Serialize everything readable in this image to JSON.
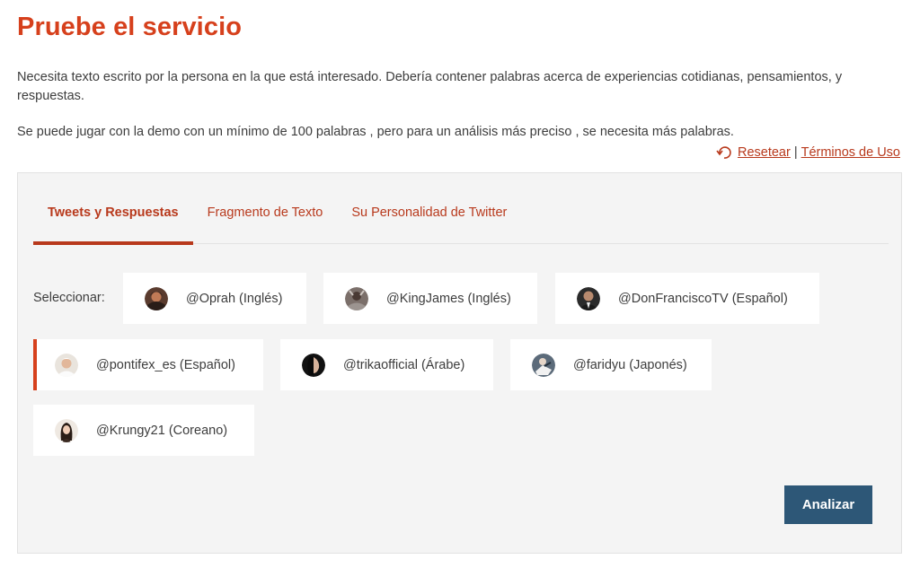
{
  "page": {
    "title": "Pruebe el servicio",
    "description_1": "Necesita texto escrito por la persona en la que está interesado. Debería contener palabras acerca de experiencias cotidianas, pensamientos, y respuestas.",
    "description_2": "Se puede jugar con la demo con un mínimo de 100 palabras , pero para un análisis más preciso , se necesita más palabras."
  },
  "links": {
    "reset": "Resetear",
    "separator": "|",
    "terms": "Términos de Uso"
  },
  "tabs": [
    {
      "label": "Tweets y Respuestas",
      "active": true
    },
    {
      "label": "Fragmento de Texto",
      "active": false
    },
    {
      "label": "Su Personalidad de Twitter",
      "active": false
    }
  ],
  "select_label": "Seleccionar:",
  "accounts": [
    {
      "label": "@Oprah (Inglés)",
      "selected": false
    },
    {
      "label": "@KingJames (Inglés)",
      "selected": false
    },
    {
      "label": "@DonFranciscoTV (Español)",
      "selected": false
    },
    {
      "label": "@pontifex_es (Español)",
      "selected": true
    },
    {
      "label": "@trikaofficial (Árabe)",
      "selected": false
    },
    {
      "label": "@faridyu (Japonés)",
      "selected": false
    },
    {
      "label": "@Krungy21 (Coreano)",
      "selected": false
    }
  ],
  "analyze_button": "Analizar",
  "colors": {
    "accent": "#d6401c",
    "link": "#b8391c",
    "button": "#2d5777",
    "panel": "#f4f4f4"
  }
}
